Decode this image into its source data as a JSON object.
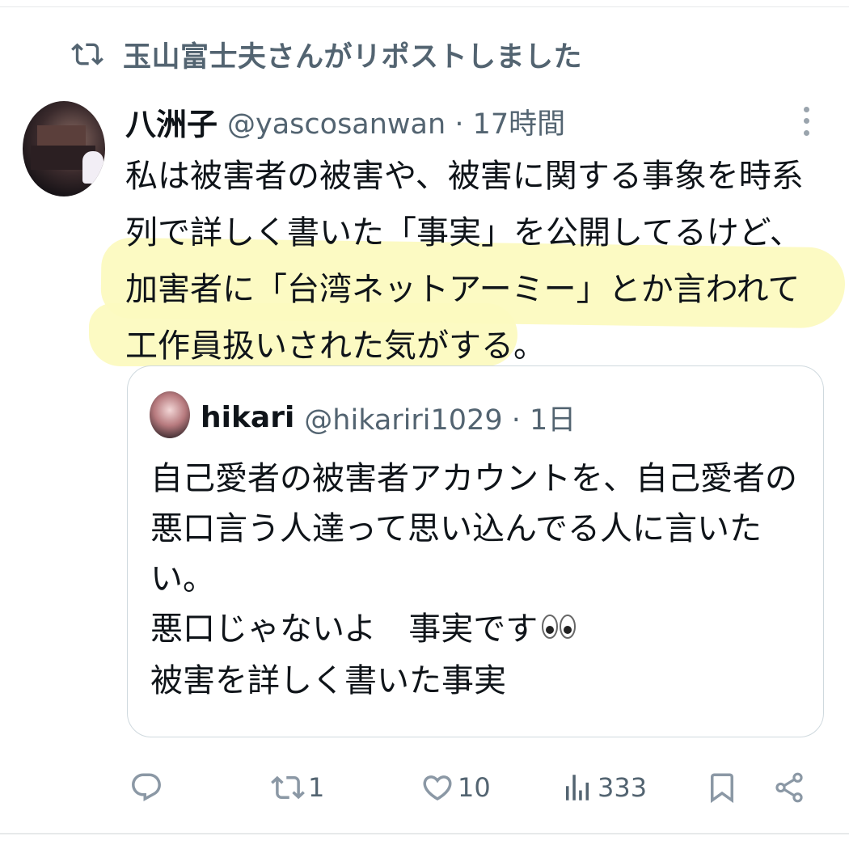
{
  "repost": {
    "text": "玉山富士夫さんがリポストしました",
    "icon": "repost-icon"
  },
  "tweet": {
    "name": "八洲子",
    "handle": "@yascosanwan · 17時間",
    "lines": [
      "私は被害者の被害や、被害に関する事象を時系",
      "列で詳しく書いた「事実」を公開してるけど、",
      "加害者に「台湾ネットアーミー」とか言われて",
      "工作員扱いされた気がする。"
    ],
    "highlight_color": "#fcfac0"
  },
  "quote": {
    "name": "hikari",
    "handle": "@hikariri1029 · 1日",
    "lines": [
      "自己愛者の被害者アカウントを、自己愛者の",
      "悪口言う人達って思い込んでる人に言いた",
      "い。",
      "悪口じゃないよ　事実です",
      "被害を詳しく書いた事実"
    ],
    "emoji": "eyes-emoji"
  },
  "actions": {
    "reply": {
      "icon": "reply-icon",
      "count": ""
    },
    "retweet": {
      "icon": "repost-icon",
      "count": "1"
    },
    "like": {
      "icon": "heart-icon",
      "count": "10"
    },
    "views": {
      "icon": "views-icon",
      "count": "333"
    },
    "bookmark": {
      "icon": "bookmark-icon",
      "count": ""
    },
    "share": {
      "icon": "share-icon",
      "count": ""
    }
  },
  "colors": {
    "text": "#0f1419",
    "muted": "#536471",
    "border": "#cfd9de"
  }
}
